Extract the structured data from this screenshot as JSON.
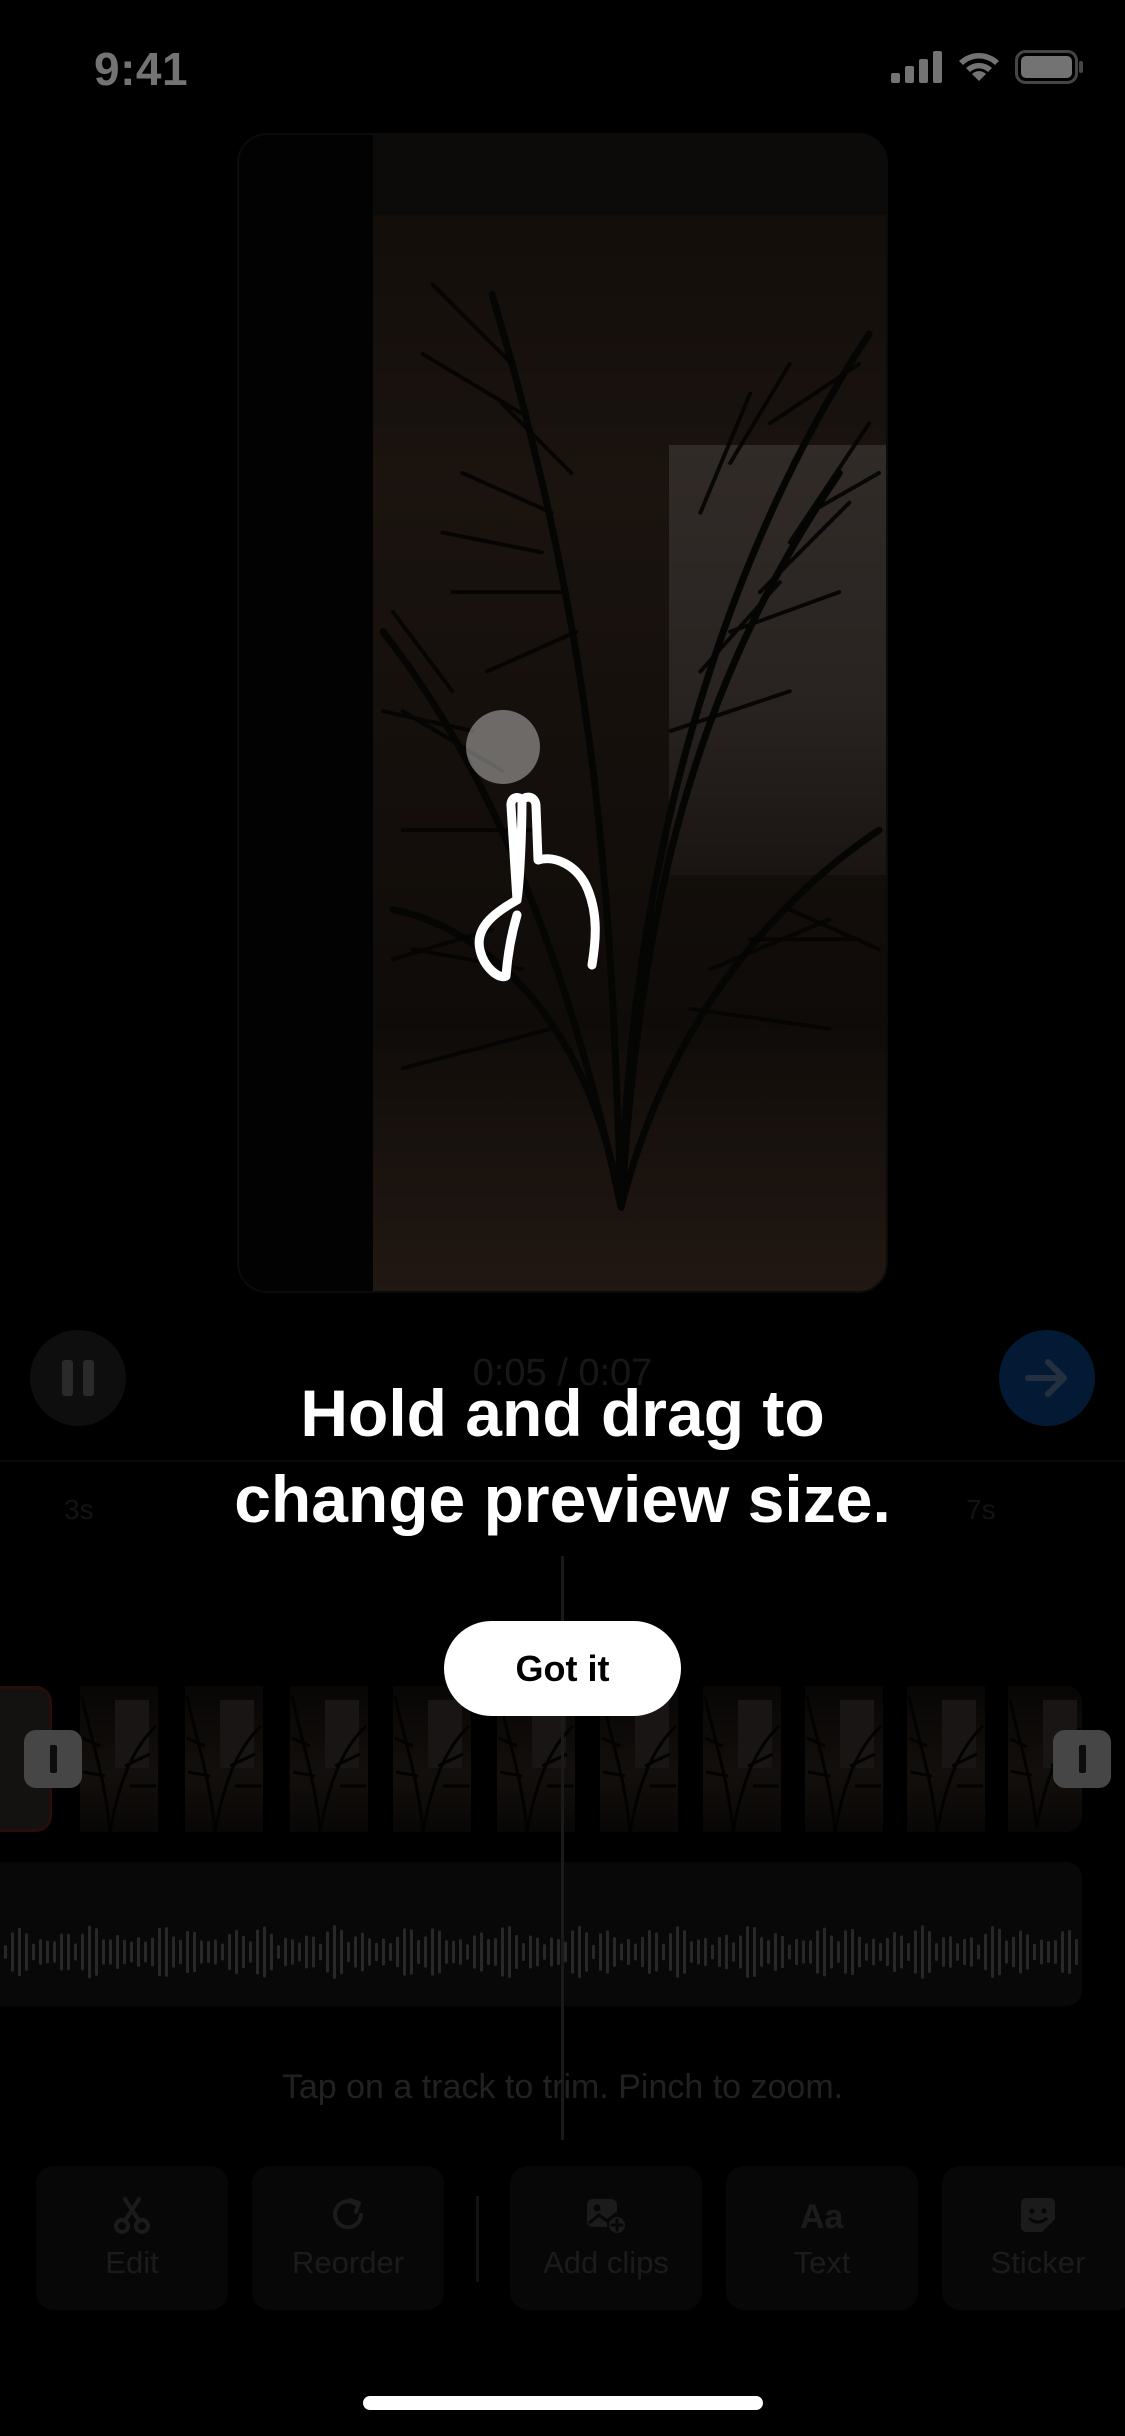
{
  "status_bar": {
    "time": "9:41",
    "icons": [
      "cellular-signal-icon",
      "wifi-icon",
      "battery-icon"
    ]
  },
  "player": {
    "timecode": "0:05 / 0:07",
    "pause_icon": "pause-icon",
    "next_icon": "arrow-right-icon",
    "next_color": "#0b3a73"
  },
  "timeline": {
    "ruler_labels": [
      "3s",
      "7s"
    ],
    "hint": "Tap on a track to trim. Pinch to zoom."
  },
  "toolbar": {
    "items": [
      {
        "label": "Edit",
        "icon": "scissors-icon"
      },
      {
        "label": "Reorder",
        "icon": "redo-icon"
      },
      {
        "label": "Add clips",
        "icon": "add-clip-icon"
      },
      {
        "label": "Text",
        "icon": "text-icon"
      },
      {
        "label": "Sticker",
        "icon": "sticker-icon"
      }
    ]
  },
  "tooltip": {
    "line1": "Hold and drag to",
    "line2": "change preview size.",
    "button": "Got it"
  }
}
